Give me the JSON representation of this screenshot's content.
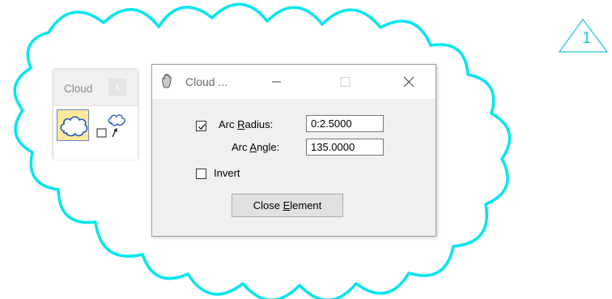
{
  "colors": {
    "cloud_outline": "#00e5ee",
    "marker": "#22c8e0",
    "tool_active_bg": "#ffe79a",
    "tool_active_border": "#6688cc"
  },
  "toolbox": {
    "title": "Cloud",
    "close_label": "x",
    "tools": [
      {
        "name": "place-cloud",
        "icon": "cloud-icon",
        "active": true
      },
      {
        "name": "cloud-edge",
        "icon": "cloud-edge-icon",
        "active": false
      }
    ]
  },
  "dialog": {
    "title": "Cloud ...",
    "icon": "app-hand-icon",
    "window_buttons": [
      "minimize-icon",
      "maximize-icon",
      "close-icon"
    ],
    "arc_radius": {
      "label_pre": "Arc ",
      "label_accel": "R",
      "label_post": "adius:",
      "checked": true,
      "value": "0:2.5000"
    },
    "arc_angle": {
      "label_pre": "Arc ",
      "label_accel": "A",
      "label_post": "ngle:",
      "value": "135.0000"
    },
    "invert": {
      "label": "Invert",
      "checked": false
    },
    "close_element": {
      "label_pre": "Close ",
      "label_accel": "E",
      "label_post": "lement"
    }
  },
  "marker": {
    "number": "1"
  }
}
